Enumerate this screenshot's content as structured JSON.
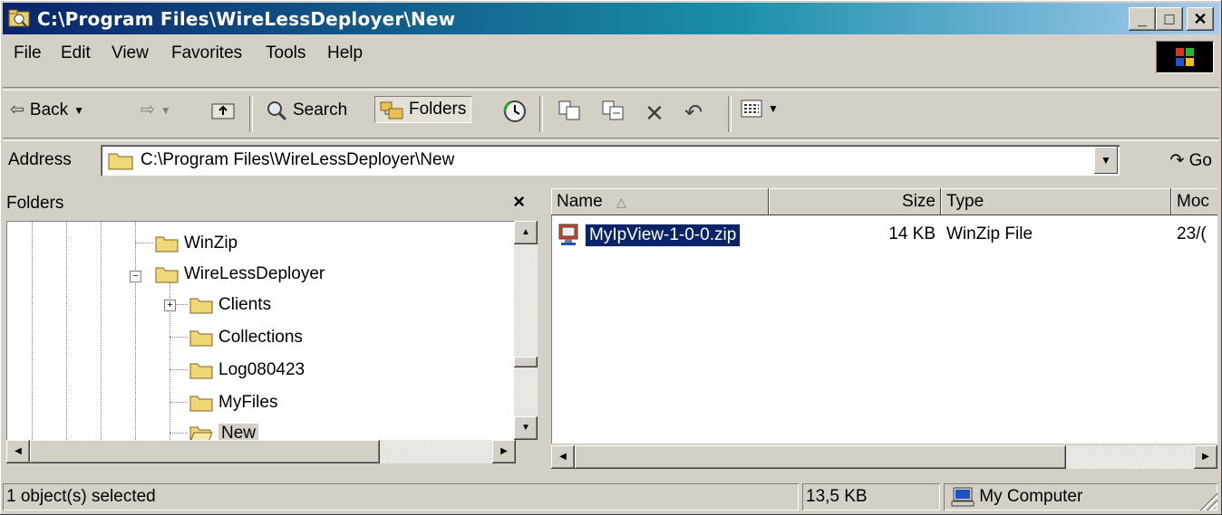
{
  "window": {
    "title": "C:\\Program Files\\WireLessDeployer\\New"
  },
  "title_buttons": {
    "minimize": "_",
    "maximize": "□",
    "close": "✕"
  },
  "menu": [
    "File",
    "Edit",
    "View",
    "Favorites",
    "Tools",
    "Help"
  ],
  "toolbar": {
    "back": "Back",
    "search": "Search",
    "folders": "Folders"
  },
  "address": {
    "label": "Address",
    "value": "C:\\Program Files\\WireLessDeployer\\New",
    "go": "Go"
  },
  "folders_pane": {
    "title": "Folders",
    "close": "×",
    "tree": [
      "WinZip",
      "WireLessDeployer",
      "Clients",
      "Collections",
      "Log080423",
      "MyFiles",
      "New"
    ]
  },
  "file_list": {
    "columns": [
      "Name",
      "Size",
      "Type",
      "Moc"
    ],
    "rows": [
      {
        "name": "MyIpView-1-0-0.zip",
        "size": "14 KB",
        "type": "WinZip File",
        "modified": "23/("
      }
    ]
  },
  "status": {
    "selected": "1 object(s) selected",
    "size": "13,5 KB",
    "zone": "My Computer"
  },
  "colors": {
    "title_start": "#0a246a",
    "title_end": "#a6caf0",
    "selection": "#0a246a",
    "face": "#d4d0c8"
  }
}
